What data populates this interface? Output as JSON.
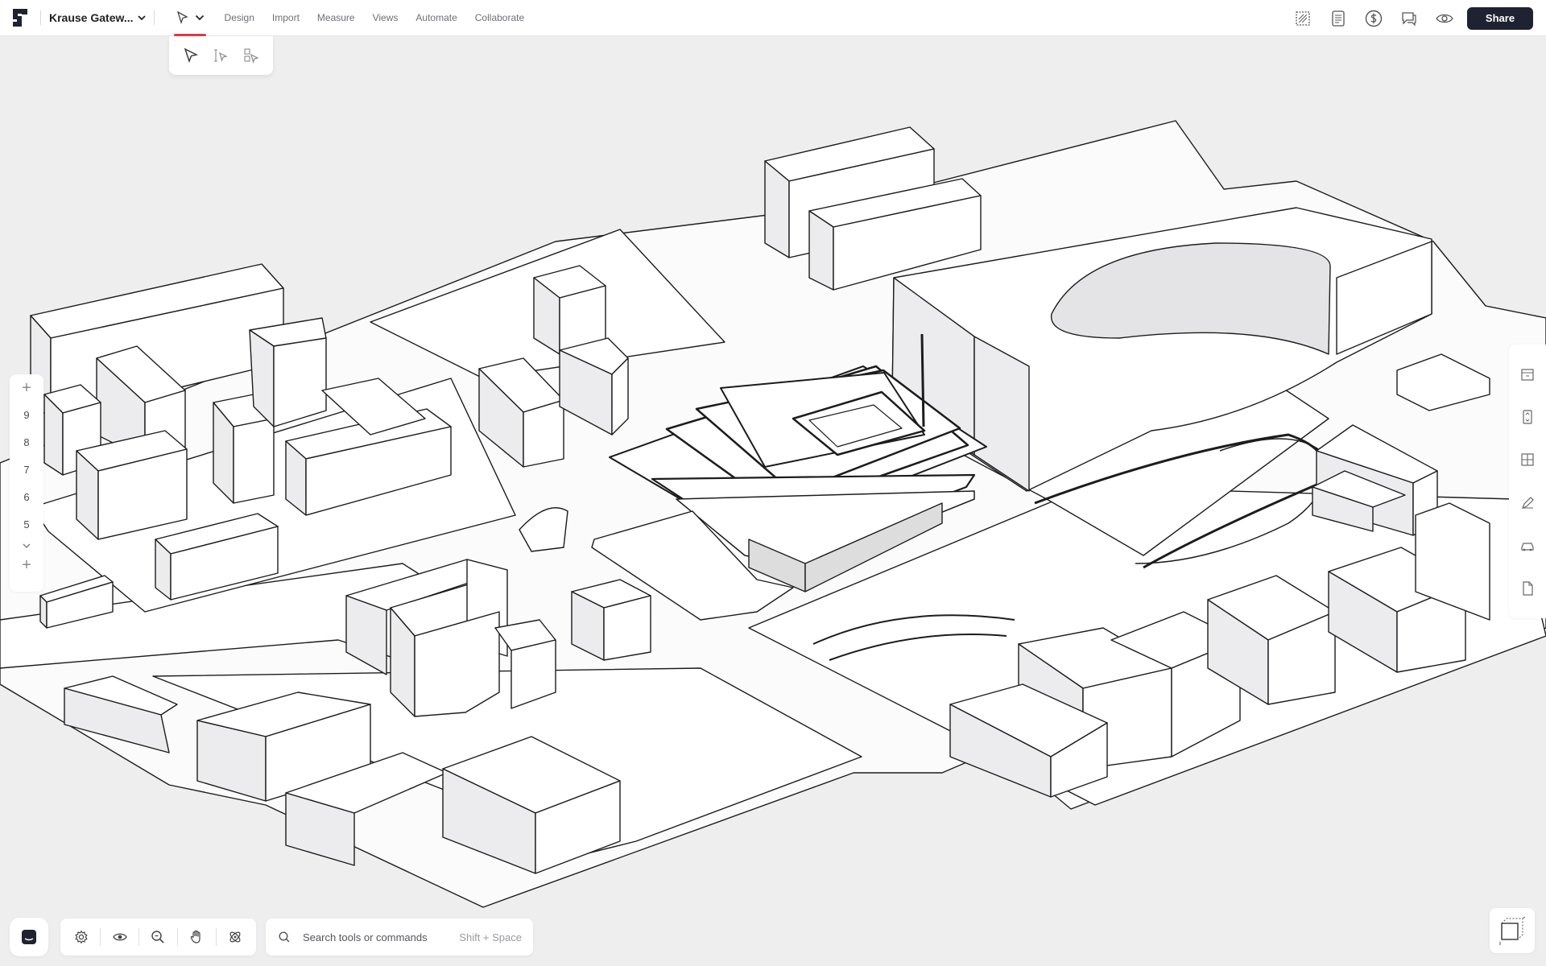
{
  "app": {
    "project_name": "Krause Gatew...",
    "accent_color": "#e2383e",
    "primary_button_color": "#1f2230"
  },
  "menu": {
    "items": [
      "Design",
      "Import",
      "Measure",
      "Views",
      "Automate",
      "Collaborate"
    ]
  },
  "toolbar_right": {
    "icons": [
      "area-icon",
      "report-icon",
      "cost-icon",
      "comments-icon",
      "preview-eye-icon"
    ],
    "share_label": "Share"
  },
  "select_submenu": {
    "icons": [
      "pointer-select-icon",
      "level-select-icon",
      "box-select-icon"
    ]
  },
  "levels": {
    "items": [
      "9",
      "8",
      "7",
      "6",
      "5"
    ]
  },
  "right_panel": {
    "icons": [
      "building-icon",
      "elevator-icon",
      "floor-plan-icon",
      "pencil-icon",
      "car-icon",
      "document-icon"
    ]
  },
  "bottom_toolbar": {
    "icons": [
      "settings-icon",
      "visibility-icon",
      "zoom-icon",
      "pan-hand-icon",
      "orbit-icon"
    ]
  },
  "search": {
    "placeholder": "Search tools or commands",
    "shortcut": "Shift + Space"
  }
}
